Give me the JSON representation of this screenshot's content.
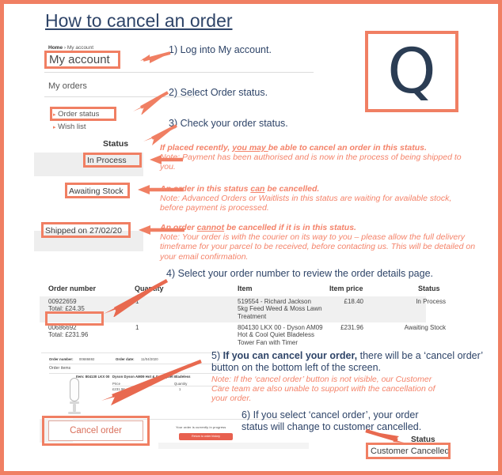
{
  "document": {
    "title": "How to cancel an order",
    "logo_letter": "Q",
    "accent_color": "#f07f63",
    "text_color": "#2e4468"
  },
  "account_screenshot": {
    "breadcrumb_home": "Home",
    "breadcrumb_sep": "›",
    "breadcrumb_current": "My account",
    "page_heading": "My account",
    "section_heading": "My orders",
    "nav_items": [
      {
        "label": "Order status"
      },
      {
        "label": "Wish list"
      }
    ],
    "status_column_label": "Status",
    "statuses": [
      {
        "label": "In Process"
      },
      {
        "label": "Awaiting Stock"
      },
      {
        "label": "Shipped on 27/02/20"
      }
    ]
  },
  "steps": [
    {
      "number": "1)",
      "text": "Log into My account."
    },
    {
      "number": "2)",
      "text": "Select Order status."
    },
    {
      "number": "3)",
      "text": "Check your order status."
    },
    {
      "number": "4)",
      "text": "Select your order number to review the order details page."
    },
    {
      "number": "5)",
      "bold_text": "If you can cancel your order,",
      "rest_line1": " there will be a ‘cancel order’",
      "rest_line2": "button on the bottom left of the screen."
    },
    {
      "number": "6)",
      "line1": "If you select ‘cancel order’, your order",
      "line2": "status will change to customer cancelled."
    }
  ],
  "notes": [
    {
      "headline_a": "If placed recently, ",
      "headline_u": "you may ",
      "headline_b": "be able to cancel an order in this status.",
      "body": "Note: Payment has been authorised and is now in the process of being shipped to you."
    },
    {
      "headline_a": "An order in this status ",
      "headline_u": "can",
      "headline_b": " be cancelled.",
      "body": "Note: Advanced Orders or Waitlists in this status are waiting for available stock, before payment is processed."
    },
    {
      "headline_a": "An order ",
      "headline_u": "cannot",
      "headline_b": " be cancelled if it is in this status.",
      "body": "Note: Your order is with the courier on its way to you – please allow the full delivery timeframe for your parcel to be received, before contacting us. This will be detailed on your email confirmation."
    },
    {
      "body": "Note: If the ‘cancel order’ button is not visible, our Customer Care team are also unable to support with the cancellation of your order."
    }
  ],
  "order_table": {
    "headers": [
      "Order number",
      "Quantity",
      "Item",
      "Item price",
      "Status"
    ],
    "rows": [
      {
        "order_number": "00922659",
        "total": "Total:  £24.35",
        "quantity": "1",
        "item": "519554 - Richard Jackson 5kg Feed Weed & Moss Lawn Treatment",
        "item_price": "£18.40",
        "status": "In Process"
      },
      {
        "order_number": "00686692",
        "total": "Total:  £231.96",
        "quantity": "1",
        "item": "804130 LKX 00 - Dyson AM09 Hot & Cool Quiet Bladeless Tower Fan with Timer",
        "item_price": "£231.96",
        "status": "Awaiting Stock"
      }
    ]
  },
  "order_detail_screenshot": {
    "order_number_label": "Order number:",
    "order_number_value": "00686692",
    "order_date_label": "Order date:",
    "order_date_value": "11/04/2020",
    "order_items_label": "Order items",
    "item_code": "Item: 804130 LKX 00",
    "item_name": "Dyson Dyson AM09 Hot & Cool Quiet Bladeless",
    "price_label": "Price",
    "quantity_label": "Quantity",
    "price_value": "£231.96",
    "quantity_value": "1",
    "progress_text": "Your order is currently in progress",
    "return_button": "Return to order history",
    "cancel_button": "Cancel order"
  },
  "final_status": {
    "column_label": "Status",
    "value": "Customer Cancelled"
  }
}
